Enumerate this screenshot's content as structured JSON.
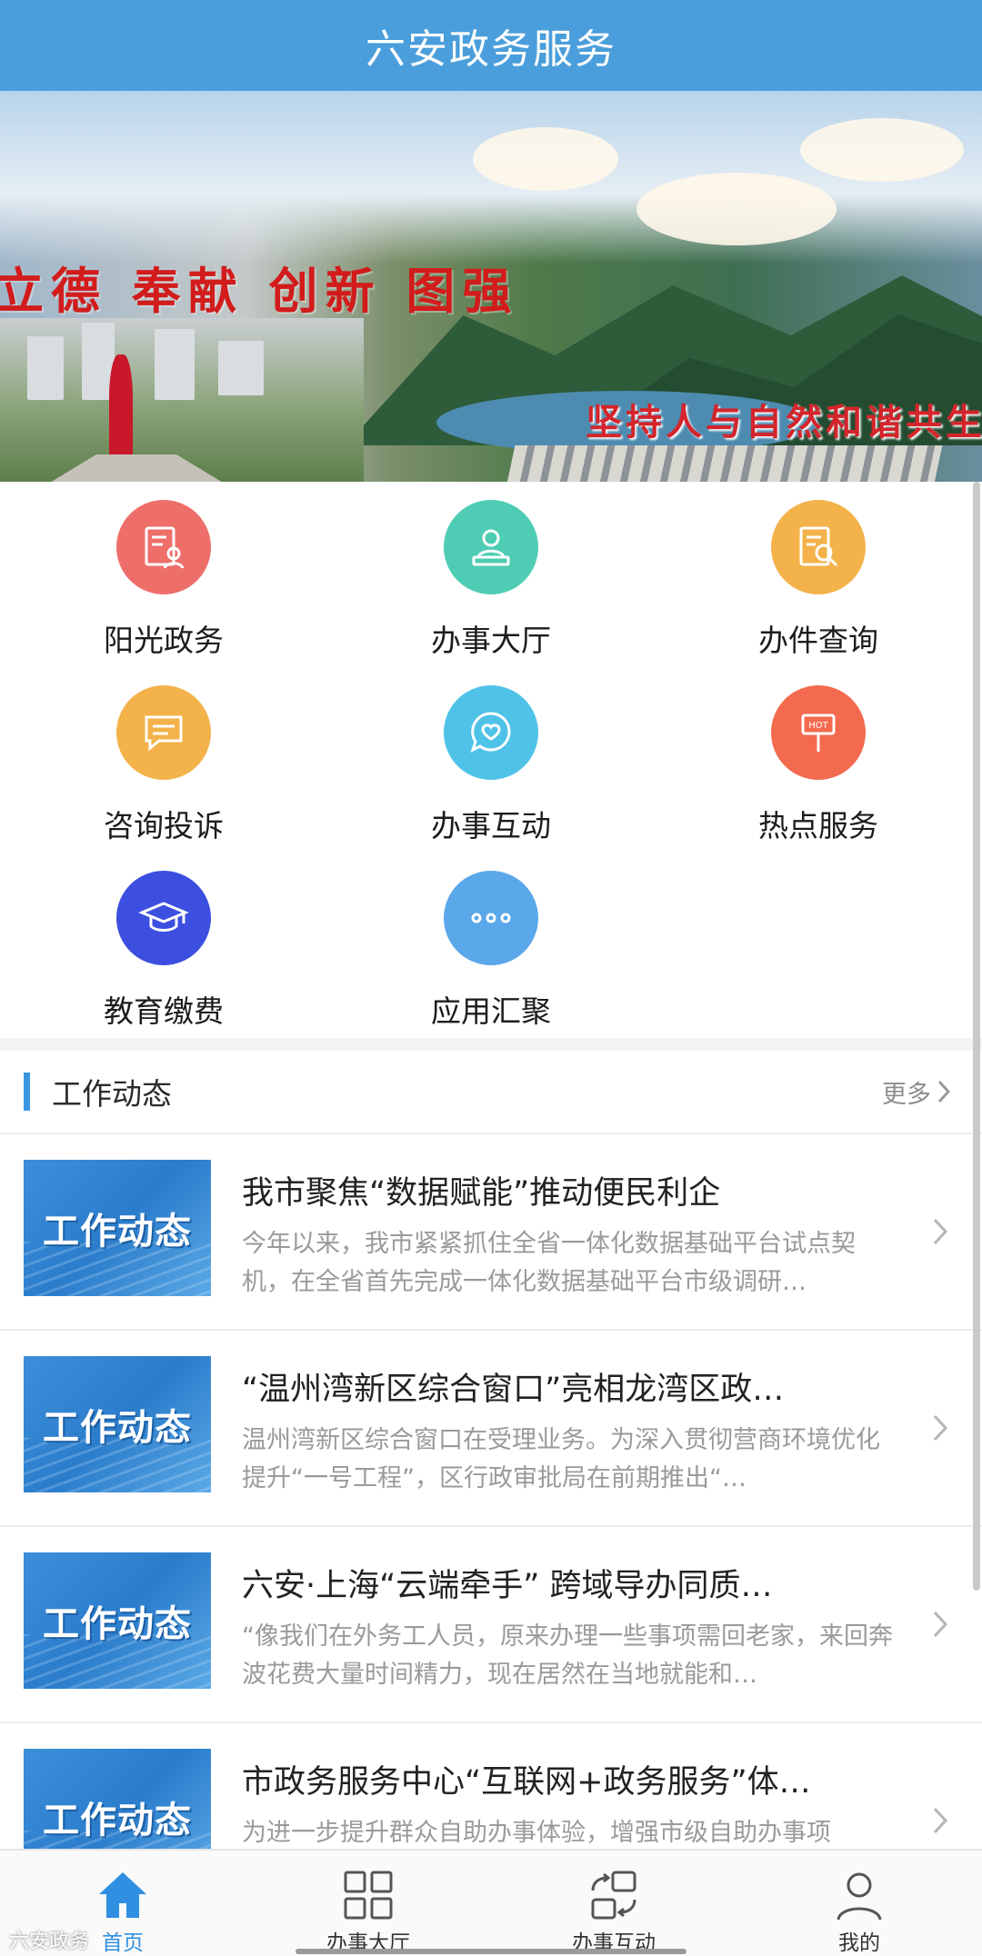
{
  "header": {
    "title": "六安政务服务"
  },
  "banner": {
    "slogan_top": "立德 奉献 创新 图强",
    "slogan_bottom": "坚持人与自然和谐共生"
  },
  "services": [
    {
      "label": "阳光政务",
      "icon": "document-user-icon",
      "color": "#ee6e6a"
    },
    {
      "label": "办事大厅",
      "icon": "person-desk-icon",
      "color": "#4ecdb4"
    },
    {
      "label": "办件查询",
      "icon": "document-search-icon",
      "color": "#f3b24a"
    },
    {
      "label": "咨询投诉",
      "icon": "chat-bubble-icon",
      "color": "#f3b24a"
    },
    {
      "label": "办事互动",
      "icon": "heart-chat-icon",
      "color": "#4fc2e8"
    },
    {
      "label": "热点服务",
      "icon": "hot-sign-icon",
      "color": "#f36a4e"
    },
    {
      "label": "教育缴费",
      "icon": "graduation-cap-icon",
      "color": "#3c4fe0"
    },
    {
      "label": "应用汇聚",
      "icon": "more-dots-icon",
      "color": "#5aa7ea"
    }
  ],
  "section": {
    "title": "工作动态",
    "more": "更多"
  },
  "news": [
    {
      "thumb_text": "工作动态",
      "title": "我市聚焦“数据赋能”推动便民利企",
      "summary": "今年以来，我市紧紧抓住全省一体化数据基础平台试点契机，在全省首先完成一体化数据基础平台市级调研…"
    },
    {
      "thumb_text": "工作动态",
      "title": "“温州湾新区综合窗口”亮相龙湾区政…",
      "summary": "温州湾新区综合窗口在受理业务。为深入贯彻营商环境优化提升“一号工程”，区行政审批局在前期推出“…"
    },
    {
      "thumb_text": "工作动态",
      "title": "六安·上海“云端牵手” 跨域导办同质…",
      "summary": "“像我们在外务工人员，原来办理一些事项需回老家，来回奔波花费大量时间精力，现在居然在当地就能和…"
    },
    {
      "thumb_text": "工作动态",
      "title": "市政务服务中心“互联网+政务服务”体…",
      "summary": "为进一步提升群众自助办事体验，增强市级自助办事项"
    }
  ],
  "tabbar": [
    {
      "label": "首页",
      "icon": "home-icon",
      "active": true
    },
    {
      "label": "办事大厅",
      "icon": "grid-icon",
      "active": false
    },
    {
      "label": "办事互动",
      "icon": "exchange-icon",
      "active": false
    },
    {
      "label": "我的",
      "icon": "user-icon",
      "active": false
    }
  ],
  "watermark": "六安政务",
  "colors": {
    "header": "#4a9edb",
    "accent": "#2f8fe0"
  }
}
